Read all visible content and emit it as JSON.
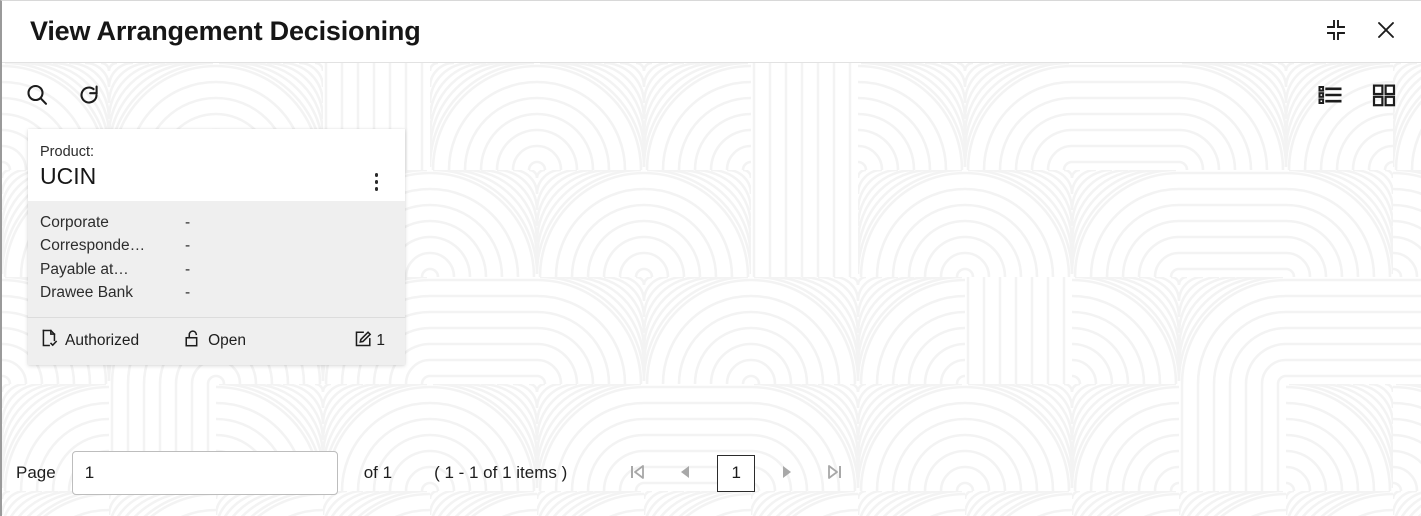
{
  "window": {
    "title": "View Arrangement Decisioning",
    "collapse_icon": "collapse-icon",
    "close_icon": "close-icon"
  },
  "toolbar": {
    "search_icon": "search-icon",
    "refresh_icon": "refresh-icon",
    "list_view_icon": "list-view-icon",
    "grid_view_icon": "grid-view-icon"
  },
  "cards": [
    {
      "header_label": "Product:",
      "header_value": "UCIN",
      "menu_icon": "kebab-menu-icon",
      "rows": [
        {
          "label": "Corporate",
          "value": "-"
        },
        {
          "label": "Corresponde…",
          "value": "-"
        },
        {
          "label": "Payable at…",
          "value": "-"
        },
        {
          "label": "Drawee Bank",
          "value": "-"
        }
      ],
      "footer": {
        "status_icon": "document-check-icon",
        "status": "Authorized",
        "state_icon": "unlock-icon",
        "state": "Open",
        "modifications_icon": "edit-square-icon",
        "modifications": "1"
      }
    }
  ],
  "pagination": {
    "page_label": "Page",
    "page_value": "1",
    "page_placeholder": "",
    "of_label": "of 1",
    "items_label": "( 1 - 1 of 1 items )",
    "first_icon": "first-page-icon",
    "prev_icon": "previous-page-icon",
    "current_page": "1",
    "next_icon": "next-page-icon",
    "last_icon": "last-page-icon"
  },
  "colors": {
    "page_background": "#ffffff",
    "watermark_line": "#f3f3f3",
    "card_body": "#efefef",
    "card_header": "#ffffff",
    "text_primary": "#1c1c1c",
    "nav_disabled": "#a8a8a8"
  }
}
